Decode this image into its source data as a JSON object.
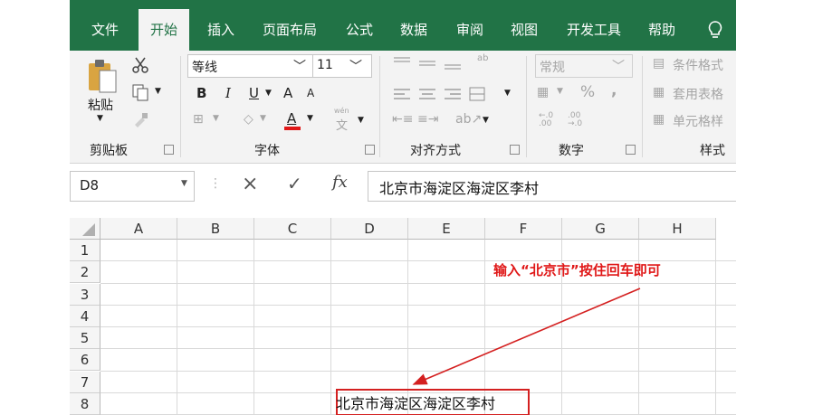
{
  "ribbon_tabs": [
    "文件",
    "开始",
    "插入",
    "页面布局",
    "公式",
    "数据",
    "审阅",
    "视图",
    "开发工具",
    "帮助"
  ],
  "active_tab": "开始",
  "clipboard": {
    "paste_label": "粘贴",
    "group_label": "剪贴板"
  },
  "font": {
    "name": "等线",
    "size": "11",
    "bold": "B",
    "italic": "I",
    "underline": "U",
    "grow": "A",
    "shrink": "A",
    "color_letter": "A",
    "phonetic_top": "wén",
    "phonetic_char": "文",
    "group_label": "字体"
  },
  "alignment": {
    "wrap_icon": "ab",
    "group_label": "对齐方式"
  },
  "number": {
    "format": "常规",
    "percent": "%",
    "comma": ",",
    "inc_decimal": "←.0 .00",
    "dec_decimal": ".00 →.0",
    "group_label": "数字"
  },
  "styles": {
    "conditional": "条件格式",
    "table": "套用表格",
    "cell": "单元格样",
    "group_label": "样式"
  },
  "formula_bar": {
    "name_box": "D8",
    "fx": "fx",
    "cancel": "×",
    "enter": "✓",
    "content": "北京市海淀区海淀区李村"
  },
  "grid": {
    "columns": [
      "A",
      "B",
      "C",
      "D",
      "E",
      "F",
      "G",
      "H"
    ],
    "rows": [
      "1",
      "2",
      "3",
      "4",
      "5",
      "6",
      "7",
      "8"
    ],
    "cell_d8": "北京市海淀区海淀区李村"
  },
  "annotation": "输入“北京市”按住回车即可",
  "colors": {
    "excel_green": "#217346",
    "annotation_red": "#e01818",
    "font_color_bar": "#e01818"
  }
}
